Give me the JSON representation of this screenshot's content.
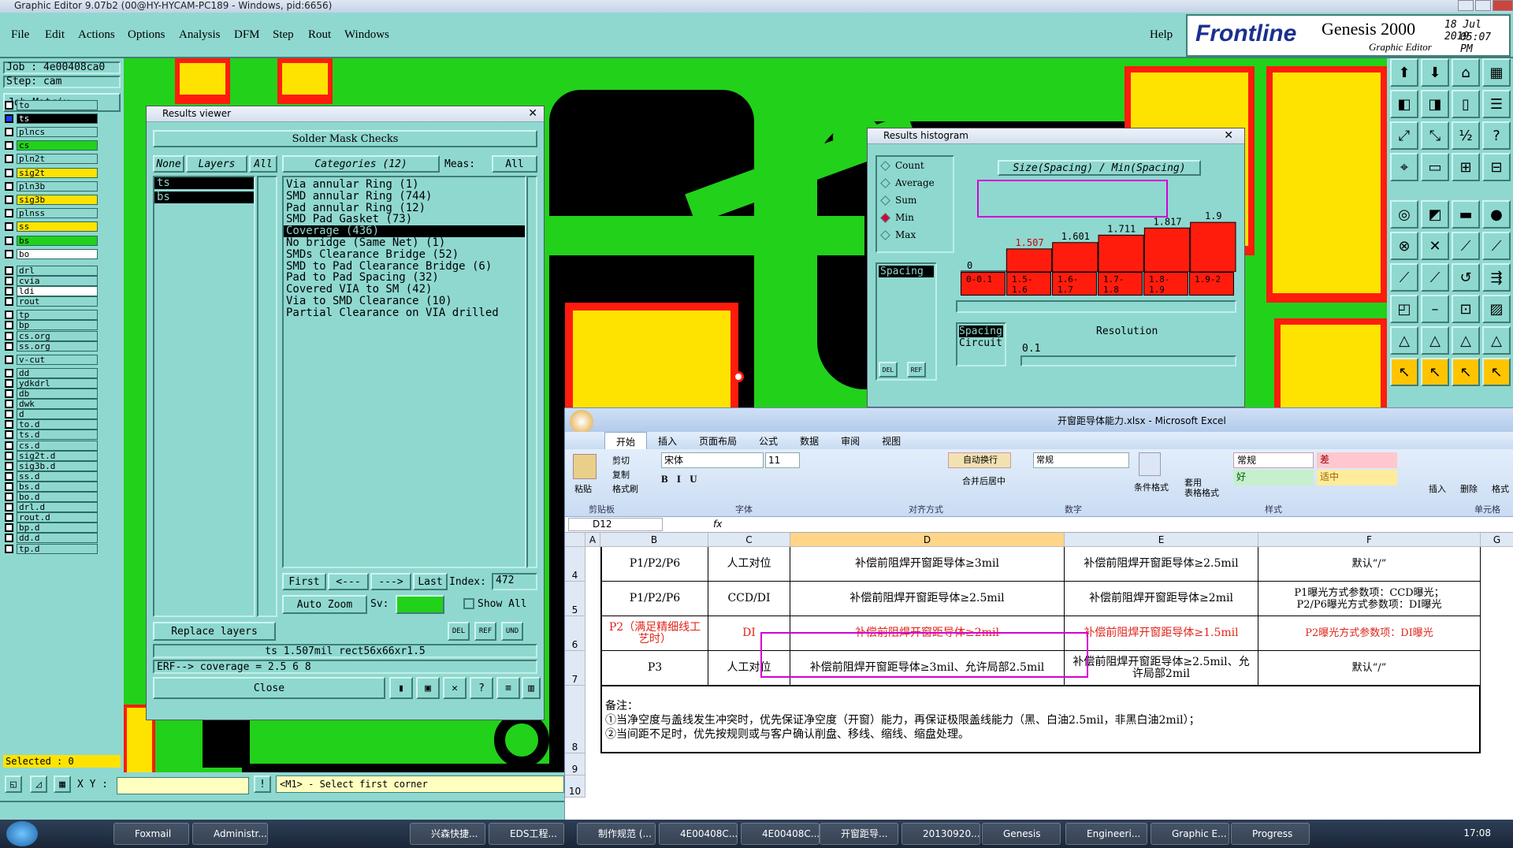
{
  "app": {
    "title": "Graphic Editor 9.07b2 (00@HY-HYCAM-PC189 - Windows, pid:6656)",
    "menu": [
      "File",
      "Edit",
      "Actions",
      "Options",
      "Analysis",
      "DFM",
      "Step",
      "Rout",
      "Windows"
    ],
    "help": "Help",
    "brand": "Frontline",
    "product": "Genesis 2000",
    "product_sub": "Graphic Editor",
    "date": "18 Jul  2019",
    "time": "05:07 PM"
  },
  "left": {
    "job": "Job : 4e00408ca0",
    "step": "Step: cam",
    "job_matrix": "Job Matrix ...",
    "layers": [
      "to",
      "ts",
      "plncs",
      "cs",
      "pln2t",
      "sig2t",
      "pln3b",
      "sig3b",
      "plnss",
      "ss",
      "bs",
      "bo",
      "drl",
      "cvia",
      "ldi",
      "rout",
      "tp",
      "bp",
      "cs.org",
      "ss.org",
      "v-cut",
      "dd",
      "ydkdrl",
      "db",
      "dwk",
      "d",
      "to.d",
      "ts.d",
      "cs.d",
      "sig2t.d",
      "sig3b.d",
      "ss.d",
      "bs.d",
      "bo.d",
      "drl.d",
      "rout.d",
      "bp.d",
      "dd.d",
      "tp.d"
    ],
    "selected": "Selected : 0",
    "xy_label": "X Y :",
    "prompt": "<M1> - Select first corner"
  },
  "results_viewer": {
    "title": "Results viewer",
    "header": "Solder Mask Checks",
    "none_btn": "None",
    "layers_btn": "Layers",
    "all_btn": "All",
    "layer_items": [
      "ts",
      "bs"
    ],
    "categories_btn": "Categories (12)",
    "meas_label": "Meas:",
    "meas_value": "All",
    "categories": [
      "Via annular Ring (1)",
      "SMD annular Ring (744)",
      "Pad annular Ring (12)",
      "SMD Pad Gasket (73)",
      "Coverage (436)",
      "No bridge (Same Net) (1)",
      "SMDs Clearance Bridge (52)",
      "SMD to Pad Clearance Bridge (6)",
      "Pad to Pad Spacing (32)",
      "Covered VIA to SM (42)",
      "Via to SMD Clearance (10)",
      "Partial Clearance on VIA drilled"
    ],
    "selected_category_index": 4,
    "first": "First",
    "prev": "<---",
    "next": "--->",
    "last": "Last",
    "index_label": "Index:",
    "index_value": "472",
    "auto_zoom": "Auto Zoom",
    "sv_label": "Sv:",
    "show_all": "Show All",
    "replace_layers": "Replace layers",
    "info_line": "ts 1.507mil  rect56x66xr1.5",
    "erf_line": "ERF--> coverage = 2.5 6 8",
    "close": "Close"
  },
  "histogram": {
    "title": "Results histogram",
    "options": [
      "Count",
      "Average",
      "Sum",
      "Min",
      "Max"
    ],
    "selected_option": "Min",
    "formula": "Size(Spacing) / Min(Spacing)",
    "spacing_item": "Spacing",
    "zero_label": "0",
    "bottom_list": [
      "Spacing",
      "Circuit"
    ],
    "resolution_label": "Resolution",
    "resolution_value": "0.1"
  },
  "chart_data": {
    "type": "bar",
    "categories": [
      "0-0.1",
      "1.5-1.6",
      "1.6-1.7",
      "1.7-1.8",
      "1.8-1.9",
      "1.9-2"
    ],
    "values": [
      0,
      1.507,
      1.601,
      1.711,
      1.817,
      1.9
    ],
    "labels": [
      "",
      "1.507",
      "1.601",
      "1.711",
      "1.817",
      "1.9"
    ]
  },
  "excel": {
    "title": "开窗距导体能力.xlsx - Microsoft Excel",
    "tabs": [
      "开始",
      "插入",
      "页面布局",
      "公式",
      "数据",
      "审阅",
      "视图"
    ],
    "font": "宋体",
    "size": "11",
    "wrap": "自动换行",
    "merge": "合并后居中",
    "number_format": "常规",
    "styles": [
      "常规",
      "差",
      "好",
      "适中"
    ],
    "clip": [
      "剪切",
      "复制",
      "格式刷"
    ],
    "paste": "粘贴",
    "cond_format": "条件格式",
    "table_format": "套用\n表格格式",
    "insert": "插入",
    "delete": "删除",
    "format": "格式",
    "groups": [
      "剪贴板",
      "字体",
      "对齐方式",
      "数字",
      "样式",
      "单元格"
    ],
    "name_box": "D12",
    "fx": "fx",
    "columns": [
      "A",
      "B",
      "C",
      "D",
      "E",
      "F",
      "G"
    ],
    "rows": [
      {
        "n": "4",
        "b": "P1/P2/P6",
        "c": "人工对位",
        "d": "补偿前阻焊开窗距导体≥3mil",
        "e": "补偿前阻焊开窗距导体≥2.5mil",
        "f": "默认“/”",
        "red": false
      },
      {
        "n": "5",
        "b": "P1/P2/P6",
        "c": "CCD/DI",
        "d": "补偿前阻焊开窗距导体≥2.5mil",
        "e": "补偿前阻焊开窗距导体≥2mil",
        "f": "P1曝光方式参数项：CCD曝光；\nP2/P6曝光方式参数项：DI曝光",
        "red": false
      },
      {
        "n": "6",
        "b": "P2（满足精细线工艺时）",
        "c": "DI",
        "d": "补偿前阻焊开窗距导体≥2mil",
        "e": "补偿前阻焊开窗距导体≥1.5mil",
        "f": "P2曝光方式参数项：DI曝光",
        "red": true
      },
      {
        "n": "7",
        "b": "P3",
        "c": "人工对位",
        "d": "补偿前阻焊开窗距导体≥3mil、允许局部2.5mil",
        "e": "补偿前阻焊开窗距导体≥2.5mil、允许局部2mil",
        "f": "默认“/”",
        "red": false
      }
    ],
    "note_row": "8",
    "notes": [
      "备注：",
      "①当净空度与盖线发生冲突时，优先保证净空度（开窗）能力，再保证极限盖线能力（黑、白油2.5mil，非黑白油2mil）；",
      "②当间距不足时，优先按规则或与客户确认削盘、移线、缩线、缩盘处理。"
    ],
    "extra_rows": [
      "9",
      "10"
    ]
  },
  "taskbar": {
    "items": [
      "Foxmail",
      "Administr...",
      "兴森快捷...",
      "EDS工程...",
      "制作规范 (...",
      "4E00408C...",
      "4E00408C...",
      "开窗距导...",
      "20130920...",
      "Genesis",
      "Engineeri...",
      "Graphic E...",
      "Progress"
    ],
    "clock": "17:08"
  },
  "colors": {
    "teal": "#8fd8d0",
    "copper_green": "#22d11a",
    "mask_red": "#ff1c0d",
    "pad_yellow": "#ffe300",
    "highlight": "#d400d4"
  }
}
